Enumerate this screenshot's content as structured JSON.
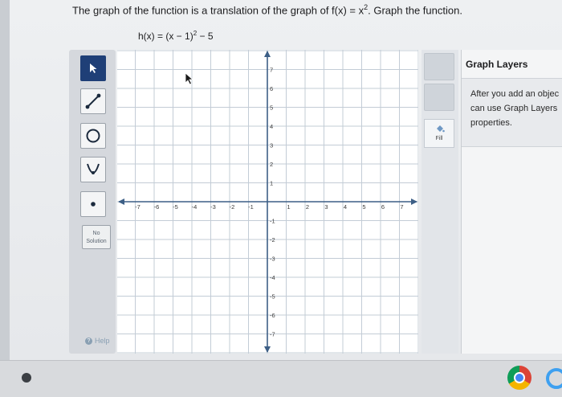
{
  "problem": {
    "prompt_before": "The graph of the function is a translation of the graph of f(x) = x",
    "prompt_exp": "2",
    "prompt_after": ". Graph the function.",
    "equation_before": "h(x) = (x − 1)",
    "equation_exp": "2",
    "equation_after": " − 5"
  },
  "toolbar": {
    "tools": [
      {
        "name": "select",
        "icon": "pointer-arrow-icon",
        "active": true
      },
      {
        "name": "line",
        "icon": "line-segment-icon"
      },
      {
        "name": "circle",
        "icon": "circle-icon"
      },
      {
        "name": "parabola",
        "icon": "parabola-icon"
      },
      {
        "name": "point",
        "icon": "point-icon"
      }
    ],
    "no_solution_line1": "No",
    "no_solution_line2": "Solution",
    "help_label": "Help"
  },
  "graph": {
    "x_min": -7,
    "x_max": 7,
    "y_min": -7,
    "y_max": 7,
    "x_tick_labels": [
      "-7",
      "-6",
      "-5",
      "-4",
      "-3",
      "-2",
      "-1",
      "1",
      "2",
      "3",
      "4",
      "5",
      "6",
      "7"
    ],
    "y_tick_labels": [
      "7",
      "6",
      "5",
      "4",
      "3",
      "2",
      "1",
      "-1",
      "-2",
      "-3",
      "-4",
      "-5",
      "-6",
      "-7"
    ],
    "grid": true,
    "axis_color": "#3d5f86",
    "grid_color": "#c3ccd6"
  },
  "side_tools": {
    "fill_label": "Fill"
  },
  "layers_panel": {
    "title": "Graph Layers",
    "line1": "After you add an objec",
    "line2": "can use Graph Layers",
    "line3": "properties."
  },
  "colors": {
    "active_tool": "#1f3f77"
  }
}
